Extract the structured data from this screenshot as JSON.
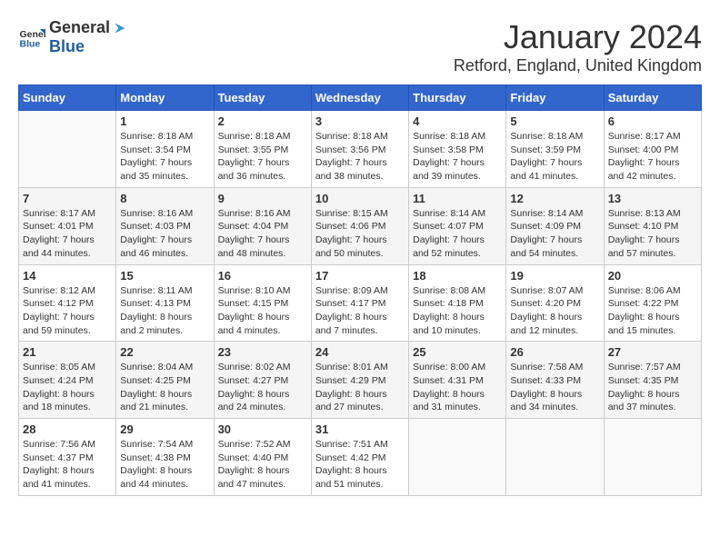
{
  "logo": {
    "text_general": "General",
    "text_blue": "Blue"
  },
  "header": {
    "month": "January 2024",
    "location": "Retford, England, United Kingdom"
  },
  "weekdays": [
    "Sunday",
    "Monday",
    "Tuesday",
    "Wednesday",
    "Thursday",
    "Friday",
    "Saturday"
  ],
  "weeks": [
    [
      {
        "day": "",
        "sunrise": "",
        "sunset": "",
        "daylight": ""
      },
      {
        "day": "1",
        "sunrise": "Sunrise: 8:18 AM",
        "sunset": "Sunset: 3:54 PM",
        "daylight": "Daylight: 7 hours and 35 minutes."
      },
      {
        "day": "2",
        "sunrise": "Sunrise: 8:18 AM",
        "sunset": "Sunset: 3:55 PM",
        "daylight": "Daylight: 7 hours and 36 minutes."
      },
      {
        "day": "3",
        "sunrise": "Sunrise: 8:18 AM",
        "sunset": "Sunset: 3:56 PM",
        "daylight": "Daylight: 7 hours and 38 minutes."
      },
      {
        "day": "4",
        "sunrise": "Sunrise: 8:18 AM",
        "sunset": "Sunset: 3:58 PM",
        "daylight": "Daylight: 7 hours and 39 minutes."
      },
      {
        "day": "5",
        "sunrise": "Sunrise: 8:18 AM",
        "sunset": "Sunset: 3:59 PM",
        "daylight": "Daylight: 7 hours and 41 minutes."
      },
      {
        "day": "6",
        "sunrise": "Sunrise: 8:17 AM",
        "sunset": "Sunset: 4:00 PM",
        "daylight": "Daylight: 7 hours and 42 minutes."
      }
    ],
    [
      {
        "day": "7",
        "sunrise": "Sunrise: 8:17 AM",
        "sunset": "Sunset: 4:01 PM",
        "daylight": "Daylight: 7 hours and 44 minutes."
      },
      {
        "day": "8",
        "sunrise": "Sunrise: 8:16 AM",
        "sunset": "Sunset: 4:03 PM",
        "daylight": "Daylight: 7 hours and 46 minutes."
      },
      {
        "day": "9",
        "sunrise": "Sunrise: 8:16 AM",
        "sunset": "Sunset: 4:04 PM",
        "daylight": "Daylight: 7 hours and 48 minutes."
      },
      {
        "day": "10",
        "sunrise": "Sunrise: 8:15 AM",
        "sunset": "Sunset: 4:06 PM",
        "daylight": "Daylight: 7 hours and 50 minutes."
      },
      {
        "day": "11",
        "sunrise": "Sunrise: 8:14 AM",
        "sunset": "Sunset: 4:07 PM",
        "daylight": "Daylight: 7 hours and 52 minutes."
      },
      {
        "day": "12",
        "sunrise": "Sunrise: 8:14 AM",
        "sunset": "Sunset: 4:09 PM",
        "daylight": "Daylight: 7 hours and 54 minutes."
      },
      {
        "day": "13",
        "sunrise": "Sunrise: 8:13 AM",
        "sunset": "Sunset: 4:10 PM",
        "daylight": "Daylight: 7 hours and 57 minutes."
      }
    ],
    [
      {
        "day": "14",
        "sunrise": "Sunrise: 8:12 AM",
        "sunset": "Sunset: 4:12 PM",
        "daylight": "Daylight: 7 hours and 59 minutes."
      },
      {
        "day": "15",
        "sunrise": "Sunrise: 8:11 AM",
        "sunset": "Sunset: 4:13 PM",
        "daylight": "Daylight: 8 hours and 2 minutes."
      },
      {
        "day": "16",
        "sunrise": "Sunrise: 8:10 AM",
        "sunset": "Sunset: 4:15 PM",
        "daylight": "Daylight: 8 hours and 4 minutes."
      },
      {
        "day": "17",
        "sunrise": "Sunrise: 8:09 AM",
        "sunset": "Sunset: 4:17 PM",
        "daylight": "Daylight: 8 hours and 7 minutes."
      },
      {
        "day": "18",
        "sunrise": "Sunrise: 8:08 AM",
        "sunset": "Sunset: 4:18 PM",
        "daylight": "Daylight: 8 hours and 10 minutes."
      },
      {
        "day": "19",
        "sunrise": "Sunrise: 8:07 AM",
        "sunset": "Sunset: 4:20 PM",
        "daylight": "Daylight: 8 hours and 12 minutes."
      },
      {
        "day": "20",
        "sunrise": "Sunrise: 8:06 AM",
        "sunset": "Sunset: 4:22 PM",
        "daylight": "Daylight: 8 hours and 15 minutes."
      }
    ],
    [
      {
        "day": "21",
        "sunrise": "Sunrise: 8:05 AM",
        "sunset": "Sunset: 4:24 PM",
        "daylight": "Daylight: 8 hours and 18 minutes."
      },
      {
        "day": "22",
        "sunrise": "Sunrise: 8:04 AM",
        "sunset": "Sunset: 4:25 PM",
        "daylight": "Daylight: 8 hours and 21 minutes."
      },
      {
        "day": "23",
        "sunrise": "Sunrise: 8:02 AM",
        "sunset": "Sunset: 4:27 PM",
        "daylight": "Daylight: 8 hours and 24 minutes."
      },
      {
        "day": "24",
        "sunrise": "Sunrise: 8:01 AM",
        "sunset": "Sunset: 4:29 PM",
        "daylight": "Daylight: 8 hours and 27 minutes."
      },
      {
        "day": "25",
        "sunrise": "Sunrise: 8:00 AM",
        "sunset": "Sunset: 4:31 PM",
        "daylight": "Daylight: 8 hours and 31 minutes."
      },
      {
        "day": "26",
        "sunrise": "Sunrise: 7:58 AM",
        "sunset": "Sunset: 4:33 PM",
        "daylight": "Daylight: 8 hours and 34 minutes."
      },
      {
        "day": "27",
        "sunrise": "Sunrise: 7:57 AM",
        "sunset": "Sunset: 4:35 PM",
        "daylight": "Daylight: 8 hours and 37 minutes."
      }
    ],
    [
      {
        "day": "28",
        "sunrise": "Sunrise: 7:56 AM",
        "sunset": "Sunset: 4:37 PM",
        "daylight": "Daylight: 8 hours and 41 minutes."
      },
      {
        "day": "29",
        "sunrise": "Sunrise: 7:54 AM",
        "sunset": "Sunset: 4:38 PM",
        "daylight": "Daylight: 8 hours and 44 minutes."
      },
      {
        "day": "30",
        "sunrise": "Sunrise: 7:52 AM",
        "sunset": "Sunset: 4:40 PM",
        "daylight": "Daylight: 8 hours and 47 minutes."
      },
      {
        "day": "31",
        "sunrise": "Sunrise: 7:51 AM",
        "sunset": "Sunset: 4:42 PM",
        "daylight": "Daylight: 8 hours and 51 minutes."
      },
      {
        "day": "",
        "sunrise": "",
        "sunset": "",
        "daylight": ""
      },
      {
        "day": "",
        "sunrise": "",
        "sunset": "",
        "daylight": ""
      },
      {
        "day": "",
        "sunrise": "",
        "sunset": "",
        "daylight": ""
      }
    ]
  ]
}
